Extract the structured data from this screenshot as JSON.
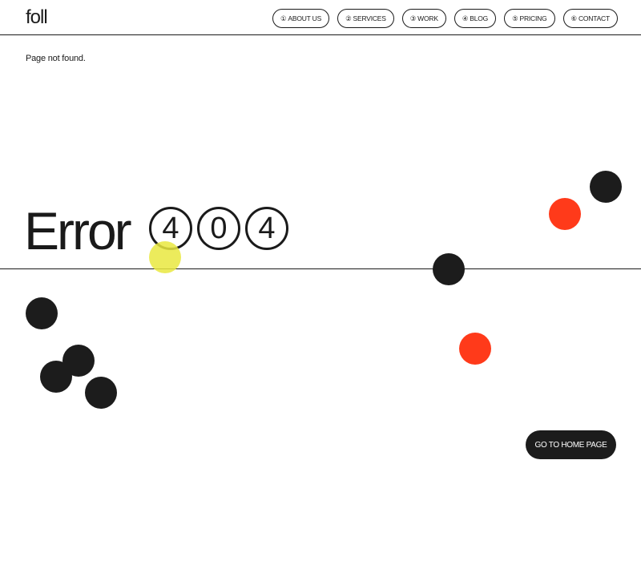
{
  "header": {
    "logo": "foll",
    "nav": [
      {
        "num": "①",
        "label": "ABOUT US"
      },
      {
        "num": "②",
        "label": "SERVICES"
      },
      {
        "num": "③",
        "label": "WORK"
      },
      {
        "num": "④",
        "label": "BLOG"
      },
      {
        "num": "⑤",
        "label": "PRICING"
      },
      {
        "num": "⑥",
        "label": "CONTACT"
      }
    ]
  },
  "main": {
    "subtitle": "Page not found.",
    "error_word": "Error",
    "digits": [
      "4",
      "0",
      "4"
    ],
    "home_button": "GO TO HOME PAGE"
  },
  "colors": {
    "ink": "#1c1c1c",
    "accent_red": "#ff3a1a",
    "accent_yellow": "#e9e83f",
    "background": "#ffffff"
  }
}
